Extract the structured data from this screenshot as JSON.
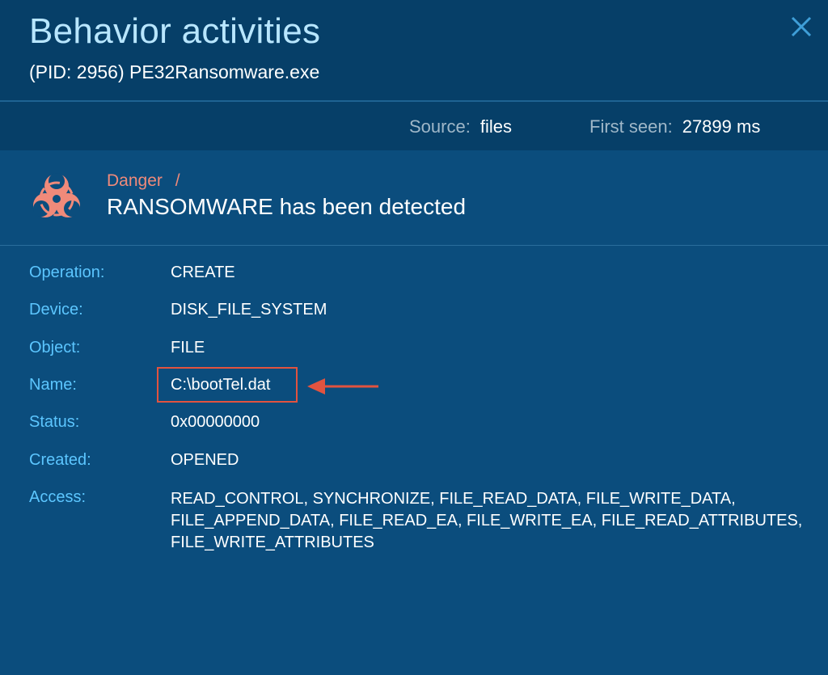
{
  "header": {
    "title": "Behavior activities",
    "subtitle": "(PID: 2956) PE32Ransomware.exe",
    "close_icon": "close-icon"
  },
  "meta": {
    "source_label": "Source:",
    "source_value": "files",
    "first_seen_label": "First seen:",
    "first_seen_value": "27899 ms"
  },
  "alert": {
    "icon": "biohazard-icon",
    "level": "Danger",
    "separator": "/",
    "message": "RANSOMWARE has been detected",
    "level_color": "#f08a7a"
  },
  "details": {
    "operation_label": "Operation:",
    "operation_value": "CREATE",
    "device_label": "Device:",
    "device_value": "DISK_FILE_SYSTEM",
    "object_label": "Object:",
    "object_value": "FILE",
    "name_label": "Name:",
    "name_value": "C:\\bootTel.dat",
    "status_label": "Status:",
    "status_value": "0x00000000",
    "created_label": "Created:",
    "created_value": "OPENED",
    "access_label": "Access:",
    "access_value": "READ_CONTROL, SYNCHRONIZE, FILE_READ_DATA, FILE_WRITE_DATA, FILE_APPEND_DATA, FILE_READ_EA, FILE_WRITE_EA, FILE_READ_ATTRIBUTES, FILE_WRITE_ATTRIBUTES"
  },
  "annotation": {
    "highlight_color": "#e2533f"
  }
}
